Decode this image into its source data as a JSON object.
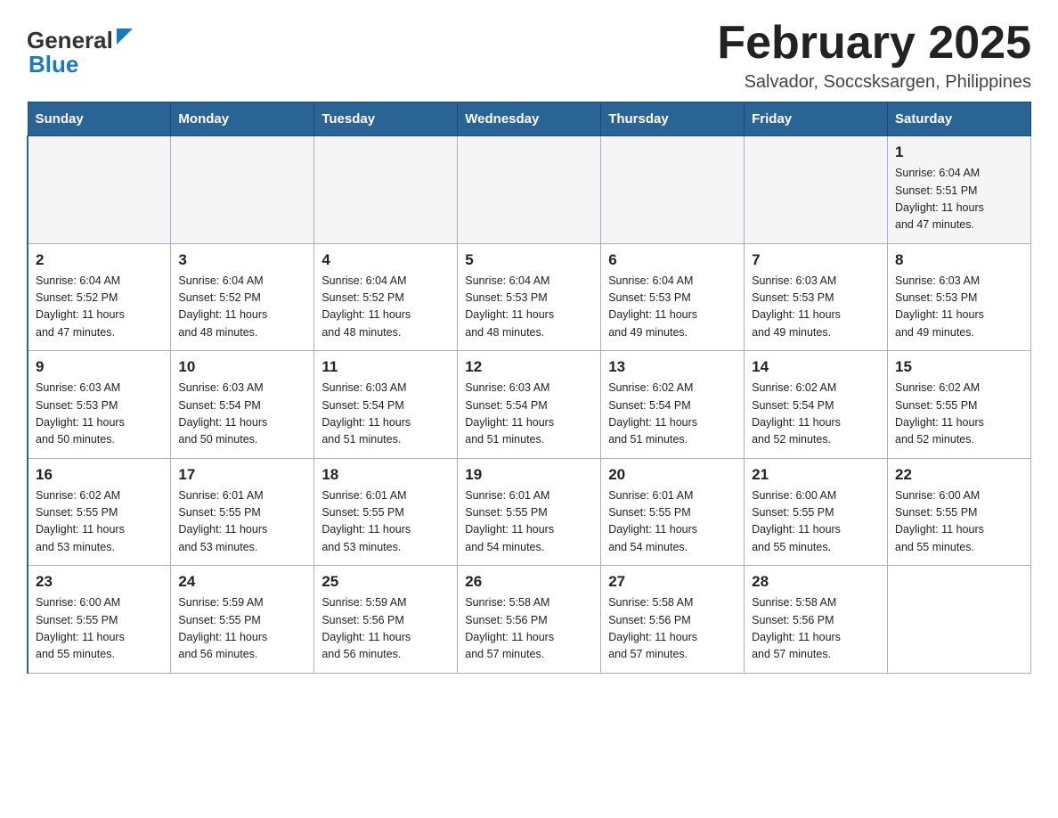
{
  "header": {
    "logo_general": "General",
    "logo_blue": "Blue",
    "month_title": "February 2025",
    "location": "Salvador, Soccsksargen, Philippines"
  },
  "days_of_week": [
    "Sunday",
    "Monday",
    "Tuesday",
    "Wednesday",
    "Thursday",
    "Friday",
    "Saturday"
  ],
  "weeks": [
    {
      "days": [
        {
          "number": "",
          "info": ""
        },
        {
          "number": "",
          "info": ""
        },
        {
          "number": "",
          "info": ""
        },
        {
          "number": "",
          "info": ""
        },
        {
          "number": "",
          "info": ""
        },
        {
          "number": "",
          "info": ""
        },
        {
          "number": "1",
          "info": "Sunrise: 6:04 AM\nSunset: 5:51 PM\nDaylight: 11 hours\nand 47 minutes."
        }
      ]
    },
    {
      "days": [
        {
          "number": "2",
          "info": "Sunrise: 6:04 AM\nSunset: 5:52 PM\nDaylight: 11 hours\nand 47 minutes."
        },
        {
          "number": "3",
          "info": "Sunrise: 6:04 AM\nSunset: 5:52 PM\nDaylight: 11 hours\nand 48 minutes."
        },
        {
          "number": "4",
          "info": "Sunrise: 6:04 AM\nSunset: 5:52 PM\nDaylight: 11 hours\nand 48 minutes."
        },
        {
          "number": "5",
          "info": "Sunrise: 6:04 AM\nSunset: 5:53 PM\nDaylight: 11 hours\nand 48 minutes."
        },
        {
          "number": "6",
          "info": "Sunrise: 6:04 AM\nSunset: 5:53 PM\nDaylight: 11 hours\nand 49 minutes."
        },
        {
          "number": "7",
          "info": "Sunrise: 6:03 AM\nSunset: 5:53 PM\nDaylight: 11 hours\nand 49 minutes."
        },
        {
          "number": "8",
          "info": "Sunrise: 6:03 AM\nSunset: 5:53 PM\nDaylight: 11 hours\nand 49 minutes."
        }
      ]
    },
    {
      "days": [
        {
          "number": "9",
          "info": "Sunrise: 6:03 AM\nSunset: 5:53 PM\nDaylight: 11 hours\nand 50 minutes."
        },
        {
          "number": "10",
          "info": "Sunrise: 6:03 AM\nSunset: 5:54 PM\nDaylight: 11 hours\nand 50 minutes."
        },
        {
          "number": "11",
          "info": "Sunrise: 6:03 AM\nSunset: 5:54 PM\nDaylight: 11 hours\nand 51 minutes."
        },
        {
          "number": "12",
          "info": "Sunrise: 6:03 AM\nSunset: 5:54 PM\nDaylight: 11 hours\nand 51 minutes."
        },
        {
          "number": "13",
          "info": "Sunrise: 6:02 AM\nSunset: 5:54 PM\nDaylight: 11 hours\nand 51 minutes."
        },
        {
          "number": "14",
          "info": "Sunrise: 6:02 AM\nSunset: 5:54 PM\nDaylight: 11 hours\nand 52 minutes."
        },
        {
          "number": "15",
          "info": "Sunrise: 6:02 AM\nSunset: 5:55 PM\nDaylight: 11 hours\nand 52 minutes."
        }
      ]
    },
    {
      "days": [
        {
          "number": "16",
          "info": "Sunrise: 6:02 AM\nSunset: 5:55 PM\nDaylight: 11 hours\nand 53 minutes."
        },
        {
          "number": "17",
          "info": "Sunrise: 6:01 AM\nSunset: 5:55 PM\nDaylight: 11 hours\nand 53 minutes."
        },
        {
          "number": "18",
          "info": "Sunrise: 6:01 AM\nSunset: 5:55 PM\nDaylight: 11 hours\nand 53 minutes."
        },
        {
          "number": "19",
          "info": "Sunrise: 6:01 AM\nSunset: 5:55 PM\nDaylight: 11 hours\nand 54 minutes."
        },
        {
          "number": "20",
          "info": "Sunrise: 6:01 AM\nSunset: 5:55 PM\nDaylight: 11 hours\nand 54 minutes."
        },
        {
          "number": "21",
          "info": "Sunrise: 6:00 AM\nSunset: 5:55 PM\nDaylight: 11 hours\nand 55 minutes."
        },
        {
          "number": "22",
          "info": "Sunrise: 6:00 AM\nSunset: 5:55 PM\nDaylight: 11 hours\nand 55 minutes."
        }
      ]
    },
    {
      "days": [
        {
          "number": "23",
          "info": "Sunrise: 6:00 AM\nSunset: 5:55 PM\nDaylight: 11 hours\nand 55 minutes."
        },
        {
          "number": "24",
          "info": "Sunrise: 5:59 AM\nSunset: 5:55 PM\nDaylight: 11 hours\nand 56 minutes."
        },
        {
          "number": "25",
          "info": "Sunrise: 5:59 AM\nSunset: 5:56 PM\nDaylight: 11 hours\nand 56 minutes."
        },
        {
          "number": "26",
          "info": "Sunrise: 5:58 AM\nSunset: 5:56 PM\nDaylight: 11 hours\nand 57 minutes."
        },
        {
          "number": "27",
          "info": "Sunrise: 5:58 AM\nSunset: 5:56 PM\nDaylight: 11 hours\nand 57 minutes."
        },
        {
          "number": "28",
          "info": "Sunrise: 5:58 AM\nSunset: 5:56 PM\nDaylight: 11 hours\nand 57 minutes."
        },
        {
          "number": "",
          "info": ""
        }
      ]
    }
  ]
}
